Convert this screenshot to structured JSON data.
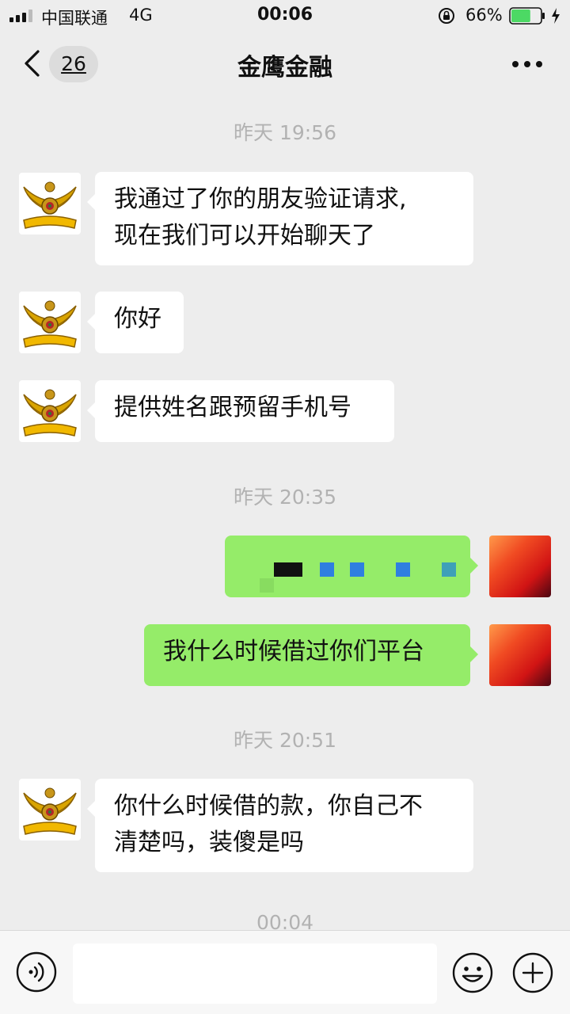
{
  "status_bar": {
    "carrier": "中国联通",
    "network": "4G",
    "time": "00:06",
    "battery_percent": "66%",
    "battery_level": 0.66,
    "battery_color": "#4cd964"
  },
  "nav": {
    "unread_count": "26",
    "title": "金鹰金融",
    "back_icon": "chevron-left-icon",
    "more_icon": "more-dots-icon"
  },
  "messages": {
    "ts1": "昨天 19:56",
    "m1_line1": "我通过了你的朋友验证请求,",
    "m1_line2": "现在我们可以开始聊天了",
    "m2": "你好",
    "m3": "提供姓名跟预留手机号",
    "ts2": "昨天 20:35",
    "m5": "我什么时候借过你们平台",
    "ts3": "昨天 20:51",
    "m6_line1": "你什么时候借的款，你自己不",
    "m6_line2": "清楚吗，装傻是吗",
    "ts4": "00:04"
  },
  "input_bar": {
    "voice_icon": "voice-icon",
    "input_value": "",
    "emoji_icon": "emoji-icon",
    "plus_icon": "plus-icon"
  },
  "colors": {
    "background": "#ededed",
    "incoming_bubble": "#ffffff",
    "outgoing_bubble": "#95ec69",
    "timestamp_text": "#b2b2b2"
  }
}
